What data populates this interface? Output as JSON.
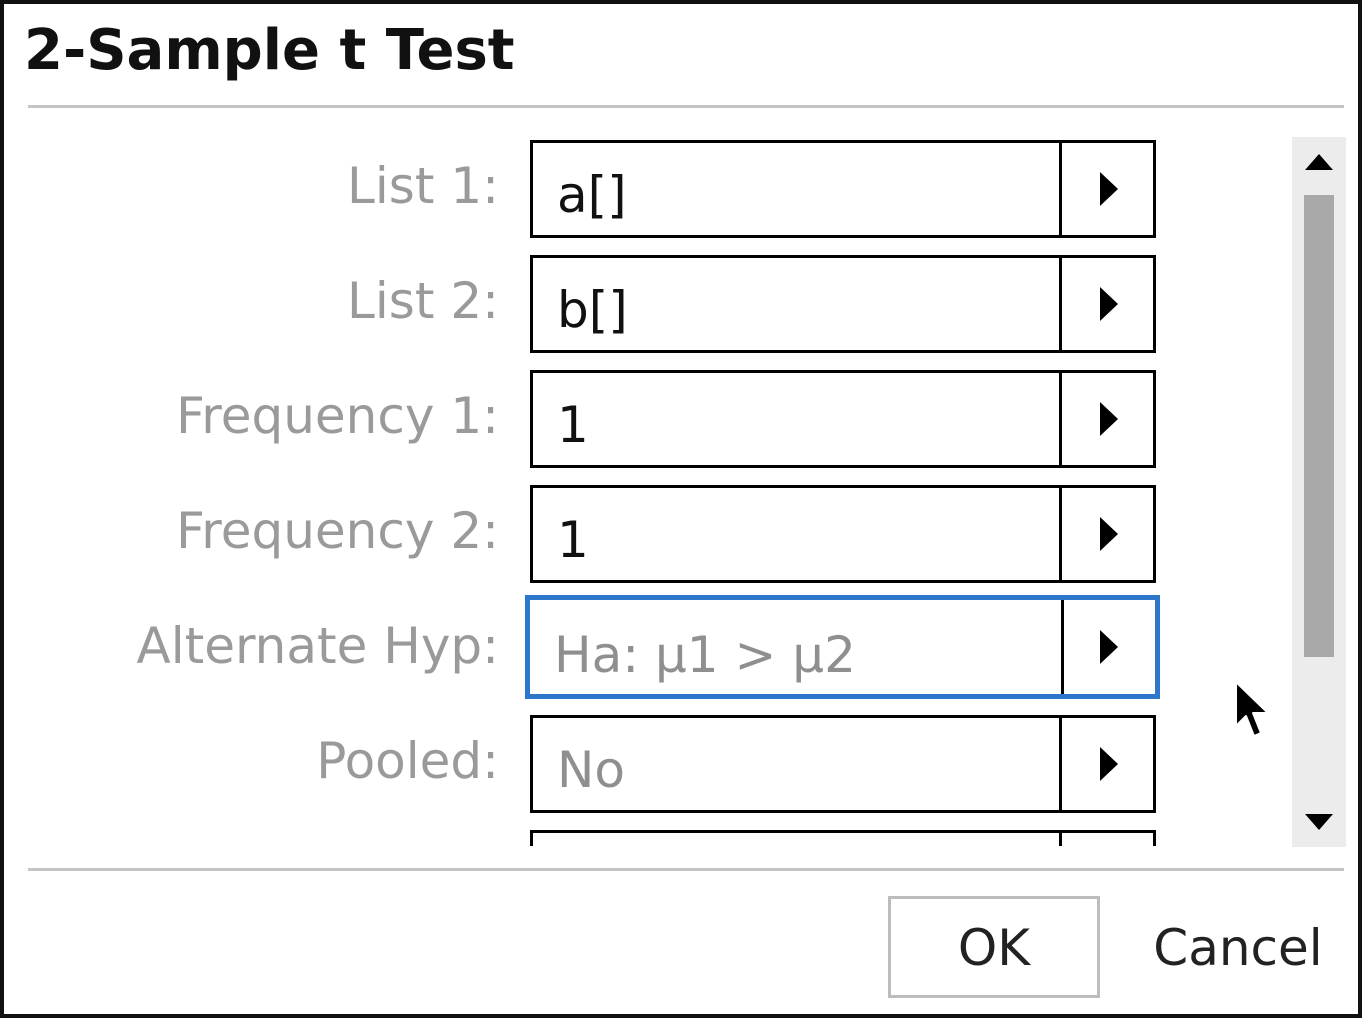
{
  "dialog": {
    "title": "2-Sample t Test"
  },
  "fields": [
    {
      "label": "List 1:",
      "value": "a[]",
      "muted": false,
      "focused": false
    },
    {
      "label": "List 2:",
      "value": "b[]",
      "muted": false,
      "focused": false
    },
    {
      "label": "Frequency 1:",
      "value": "1",
      "muted": false,
      "focused": false
    },
    {
      "label": "Frequency 2:",
      "value": "1",
      "muted": false,
      "focused": false
    },
    {
      "label": "Alternate Hyp:",
      "value": "Ha: μ1 > μ2",
      "muted": true,
      "focused": true
    },
    {
      "label": "Pooled:",
      "value": "No",
      "muted": true,
      "focused": false
    }
  ],
  "buttons": {
    "ok": "OK",
    "cancel": "Cancel"
  },
  "colors": {
    "focus": "#2c77c9",
    "label": "#9a9a9a",
    "divider": "#c4c4c4"
  },
  "icons": {
    "dropdown": "triangle-right-icon",
    "scroll_up": "triangle-up-icon",
    "scroll_down": "triangle-down-icon",
    "cursor": "mouse-pointer-icon"
  }
}
